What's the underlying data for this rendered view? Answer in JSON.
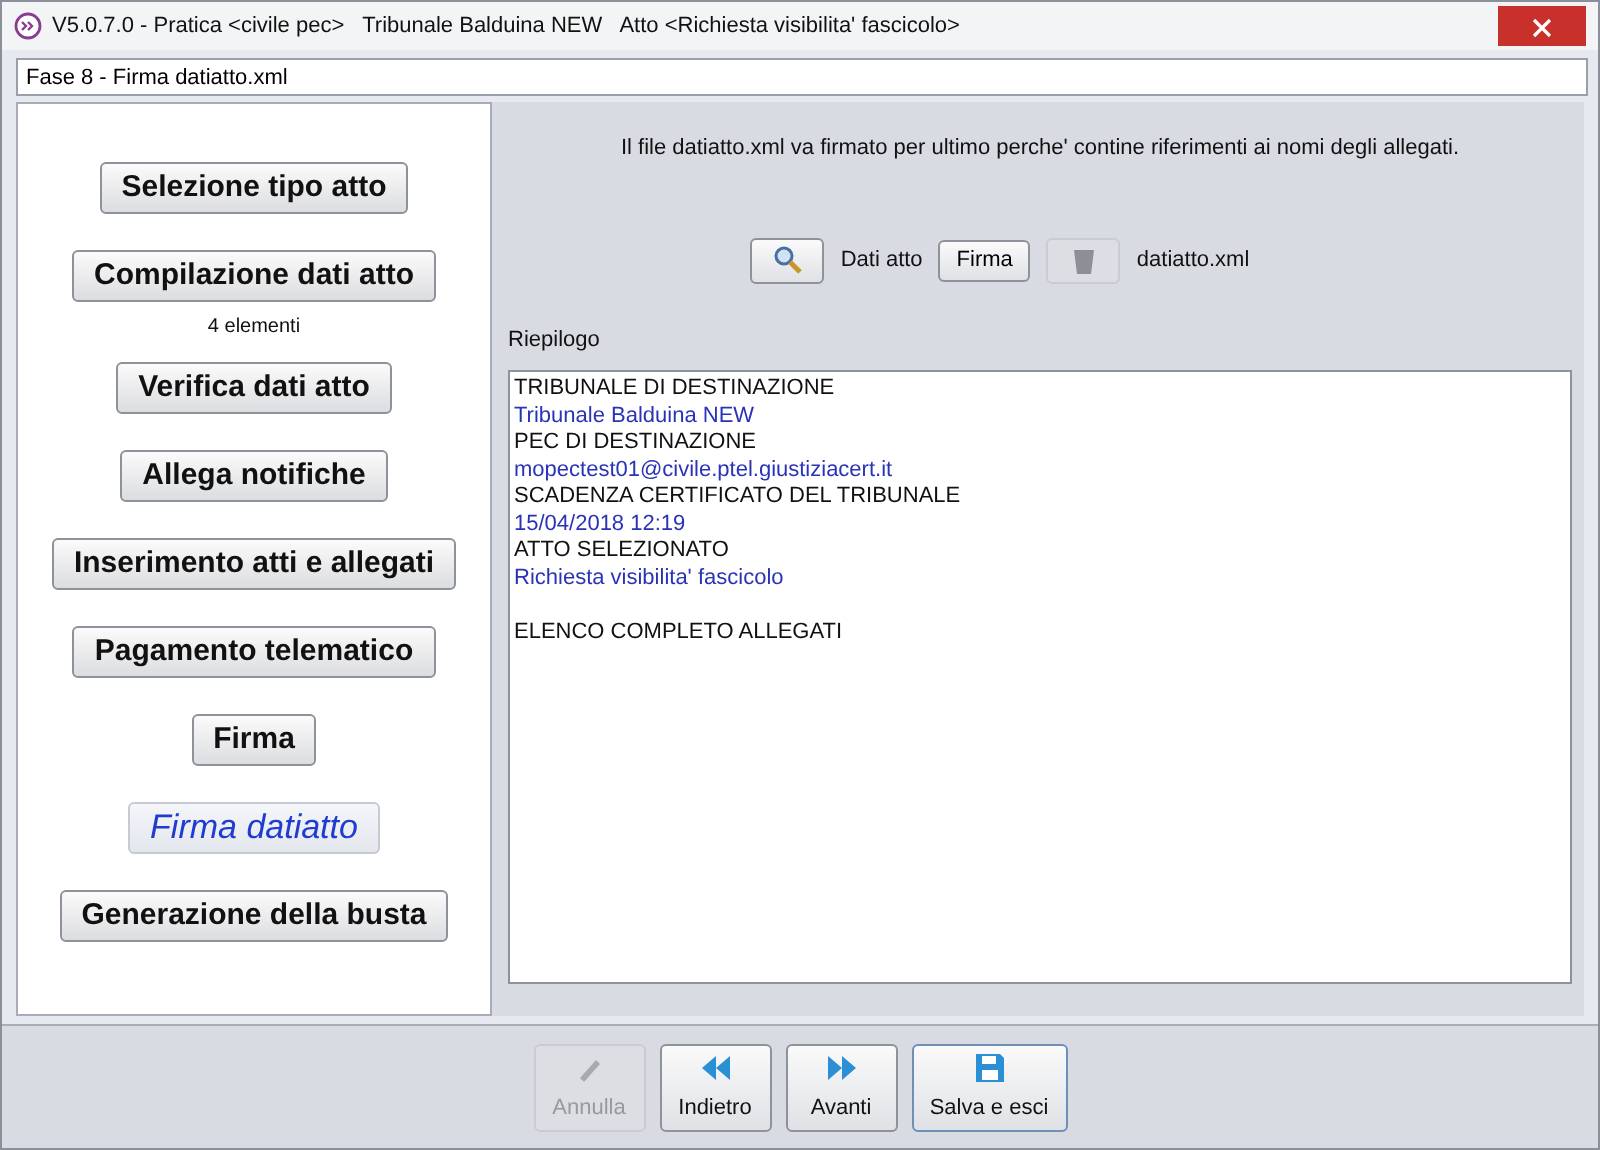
{
  "window": {
    "title": "V5.0.7.0 - Pratica <civile pec>   Tribunale Balduina NEW   Atto <Richiesta visibilita' fascicolo>"
  },
  "phase": {
    "value": "Fase 8 - Firma datiatto.xml"
  },
  "steps": [
    {
      "label": "Selezione tipo atto",
      "selected": false
    },
    {
      "label": "Compilazione dati atto",
      "selected": false,
      "note": "4 elementi"
    },
    {
      "label": "Verifica dati atto",
      "selected": false
    },
    {
      "label": "Allega notifiche",
      "selected": false
    },
    {
      "label": "Inserimento atti e allegati",
      "selected": false
    },
    {
      "label": "Pagamento telematico",
      "selected": false
    },
    {
      "label": "Firma",
      "selected": false
    },
    {
      "label": "Firma datiatto",
      "selected": true
    },
    {
      "label": "Generazione della busta",
      "selected": false
    }
  ],
  "message": "Il file datiatto.xml va firmato per ultimo perche' contine riferimenti ai nomi degli allegati.",
  "file_row": {
    "view_label": "Dati atto",
    "sign_button": "Firma",
    "delete_disabled": true,
    "file_name": "datiatto.xml"
  },
  "summary": {
    "title": "Riepilogo",
    "lines": [
      {
        "text": "TRIBUNALE DI DESTINAZIONE",
        "kind": "heading"
      },
      {
        "text": "Tribunale Balduina NEW",
        "kind": "value"
      },
      {
        "text": "PEC DI DESTINAZIONE",
        "kind": "heading"
      },
      {
        "text": "mopectest01@civile.ptel.giustiziacert.it",
        "kind": "value"
      },
      {
        "text": "SCADENZA CERTIFICATO DEL TRIBUNALE",
        "kind": "heading"
      },
      {
        "text": "15/04/2018 12:19",
        "kind": "value"
      },
      {
        "text": "ATTO SELEZIONATO",
        "kind": "heading"
      },
      {
        "text": "Richiesta visibilita' fascicolo",
        "kind": "value"
      },
      {
        "text": "ELENCO COMPLETO ALLEGATI",
        "kind": "heading",
        "gap_before": true
      }
    ]
  },
  "actions": [
    {
      "label": "Annulla",
      "kind": "cancel",
      "disabled": true
    },
    {
      "label": "Indietro",
      "kind": "back",
      "disabled": false
    },
    {
      "label": "Avanti",
      "kind": "forward",
      "disabled": false
    },
    {
      "label": "Salva e esci",
      "kind": "save",
      "disabled": false
    }
  ]
}
